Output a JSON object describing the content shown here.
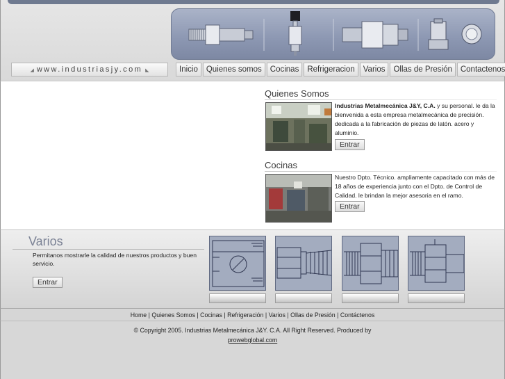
{
  "header": {
    "url": "www.industriasjy.com"
  },
  "nav": {
    "items": [
      "Inicio",
      "Quienes somos",
      "Cocinas",
      "Refrigeracion",
      "Varios",
      "Ollas de Presión",
      "Contactenos"
    ]
  },
  "quienes": {
    "title": "Quienes Somos",
    "company": "Industrias Metalmecánica J&Y, C.A.",
    "text": " y su personal. le da la bienvenida a esta empresa metalmecánica de precisión. dedicada a la fabricación de piezas de latón. acero y aluminio.",
    "button": "Entrar"
  },
  "cocinas": {
    "title": "Cocinas",
    "text": "Nuestro Dpto. Técnico. ampliamente capacitado con más de 18 años de experiencia junto con el Dpto. de Control de Calidad. le brindan la mejor asesoria en el ramo.",
    "button": "Entrar"
  },
  "varios": {
    "title": "Varios",
    "text": "Permitanos mostrarle la calidad de nuestros productos y buen servicio.",
    "button": "Entrar"
  },
  "footer": {
    "links": [
      "Home",
      "Quienes Somos",
      "Cocinas",
      "Refrigeración",
      "Varios",
      "Ollas de Presión",
      "Contáctenos"
    ],
    "copyright": "© Copyright 2005. Industrias Metalmecánica J&Y. C.A. All Right Reserved. Produced by",
    "producer": "prowebglobal.com"
  },
  "colors": {
    "banner": "#8c97b2",
    "accent": "#7b8295",
    "background": "#d7d7d7"
  },
  "icons": {
    "url_arrow_left": "triangle-left-icon",
    "url_arrow_right": "triangle-right-icon"
  }
}
